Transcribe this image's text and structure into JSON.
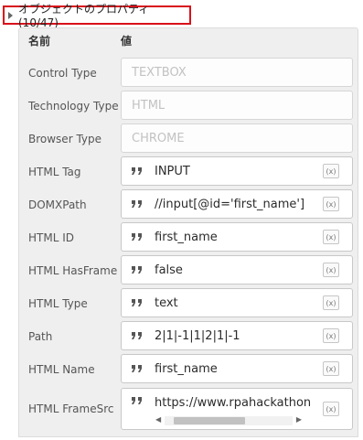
{
  "header": {
    "title": "オブジェクトのプロパティ (10/47)"
  },
  "columns": {
    "name": "名前",
    "value": "値"
  },
  "properties": [
    {
      "label": "Control Type",
      "value": "TEXTBOX"
    },
    {
      "label": "Technology Type",
      "value": "HTML"
    },
    {
      "label": "Browser Type",
      "value": "CHROME"
    },
    {
      "label": "HTML Tag",
      "value": "INPUT"
    },
    {
      "label": "DOMXPath",
      "value": "//input[@id='first_name']"
    },
    {
      "label": "HTML ID",
      "value": "first_name"
    },
    {
      "label": "HTML HasFrame",
      "value": "false"
    },
    {
      "label": "HTML Type",
      "value": "text"
    },
    {
      "label": "Path",
      "value": "2|1|-1|1|2|1|-1"
    },
    {
      "label": "HTML Name",
      "value": "first_name"
    },
    {
      "label": "HTML FrameSrc",
      "value": "https://www.rpahackathon"
    }
  ],
  "icons": {
    "quote": "quote-icon",
    "variable": "variable-icon",
    "expand": "caret-right-icon"
  },
  "variable_button_text": "(x)",
  "colors": {
    "highlight_border": "#d9101a",
    "panel_bg": "#efefef"
  }
}
